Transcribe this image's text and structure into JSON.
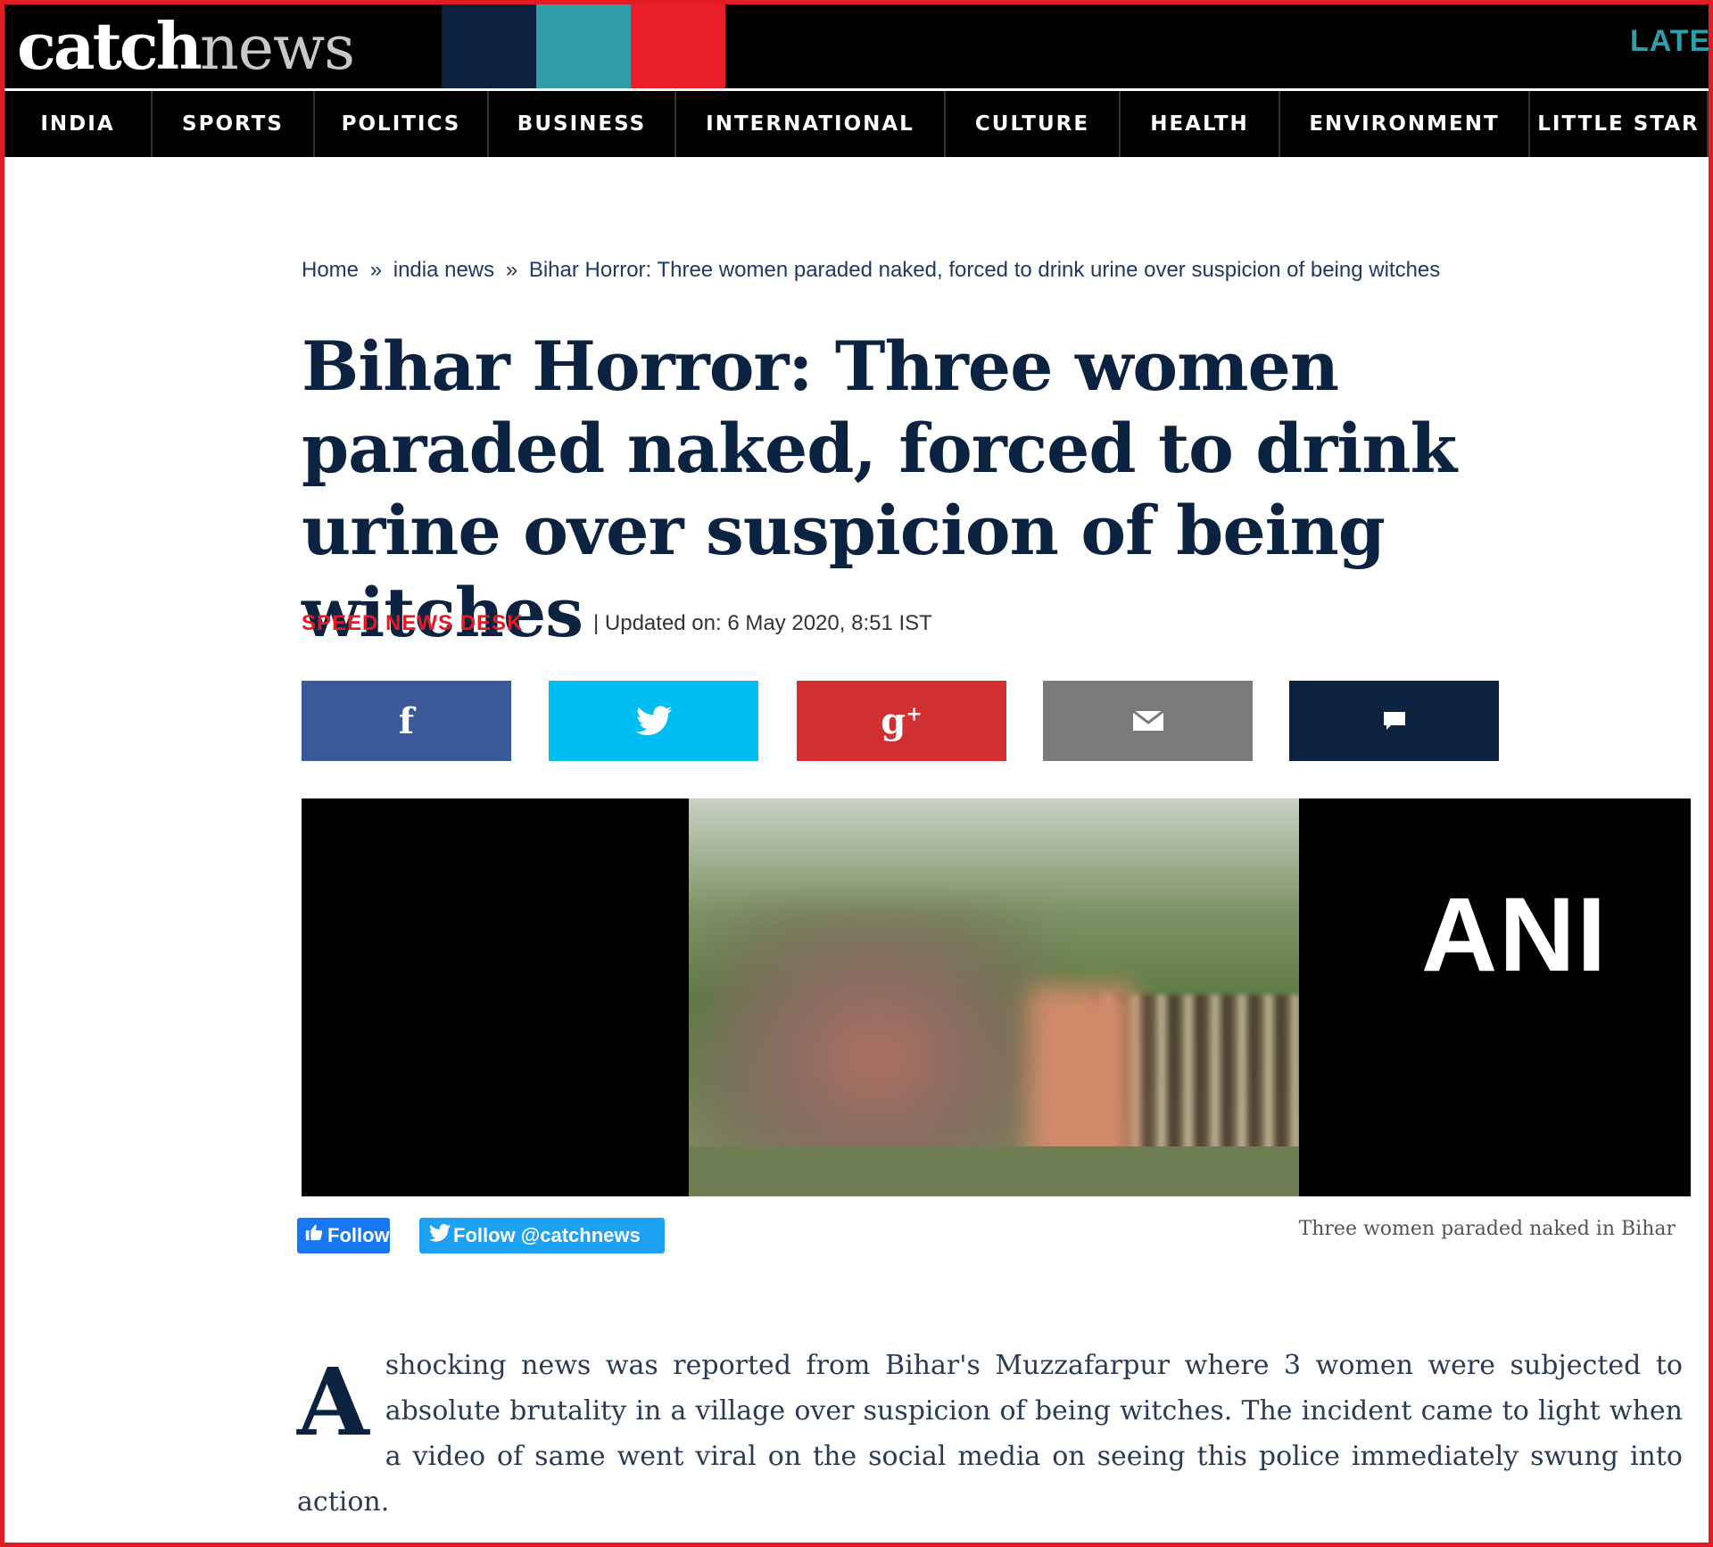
{
  "logo": {
    "catch": "catch",
    "news": "news"
  },
  "header": {
    "latest_label": "LATEST"
  },
  "nav": {
    "items": [
      "INDIA",
      "SPORTS",
      "POLITICS",
      "BUSINESS",
      "INTERNATIONAL",
      "CULTURE",
      "HEALTH",
      "ENVIRONMENT",
      "LITTLE STAR"
    ]
  },
  "breadcrumb": {
    "home": "Home",
    "section": "india news",
    "current": "Bihar Horror: Three women paraded naked, forced to drink urine over suspicion of being witches",
    "separator": "»"
  },
  "article": {
    "headline": "Bihar Horror: Three women paraded naked, forced to drink urine over suspicion of being witches",
    "author": "SPEED NEWS DESK",
    "updated": "| Updated on: 6 May 2020, 8:51 IST",
    "image_watermark": "ANI",
    "caption": "Three women paraded naked in Bihar",
    "dropcap": "A",
    "body": "shocking news was reported from Bihar's Muzzafarpur where 3 women were subjected to absolute brutality in a village over suspicion of being witches. The incident came to light when a video of same went viral on the social media on seeing this police immediately swung into action."
  },
  "share": {
    "facebook_icon": "facebook-icon",
    "twitter_icon": "twitter-icon",
    "googleplus_icon": "google-plus-icon",
    "email_icon": "email-icon",
    "comment_icon": "comment-icon"
  },
  "social": {
    "fb_follow_label": "Follow",
    "tw_follow_label": "Follow @catchnews"
  },
  "colors": {
    "brand_navy": "#0b2340",
    "brand_teal": "#2f9ea8",
    "brand_red": "#e91e28",
    "author_red": "#e31b23",
    "facebook": "#3b5998",
    "twitter": "#00bdf2",
    "googleplus": "#d23030",
    "email": "#7a7a7a"
  }
}
